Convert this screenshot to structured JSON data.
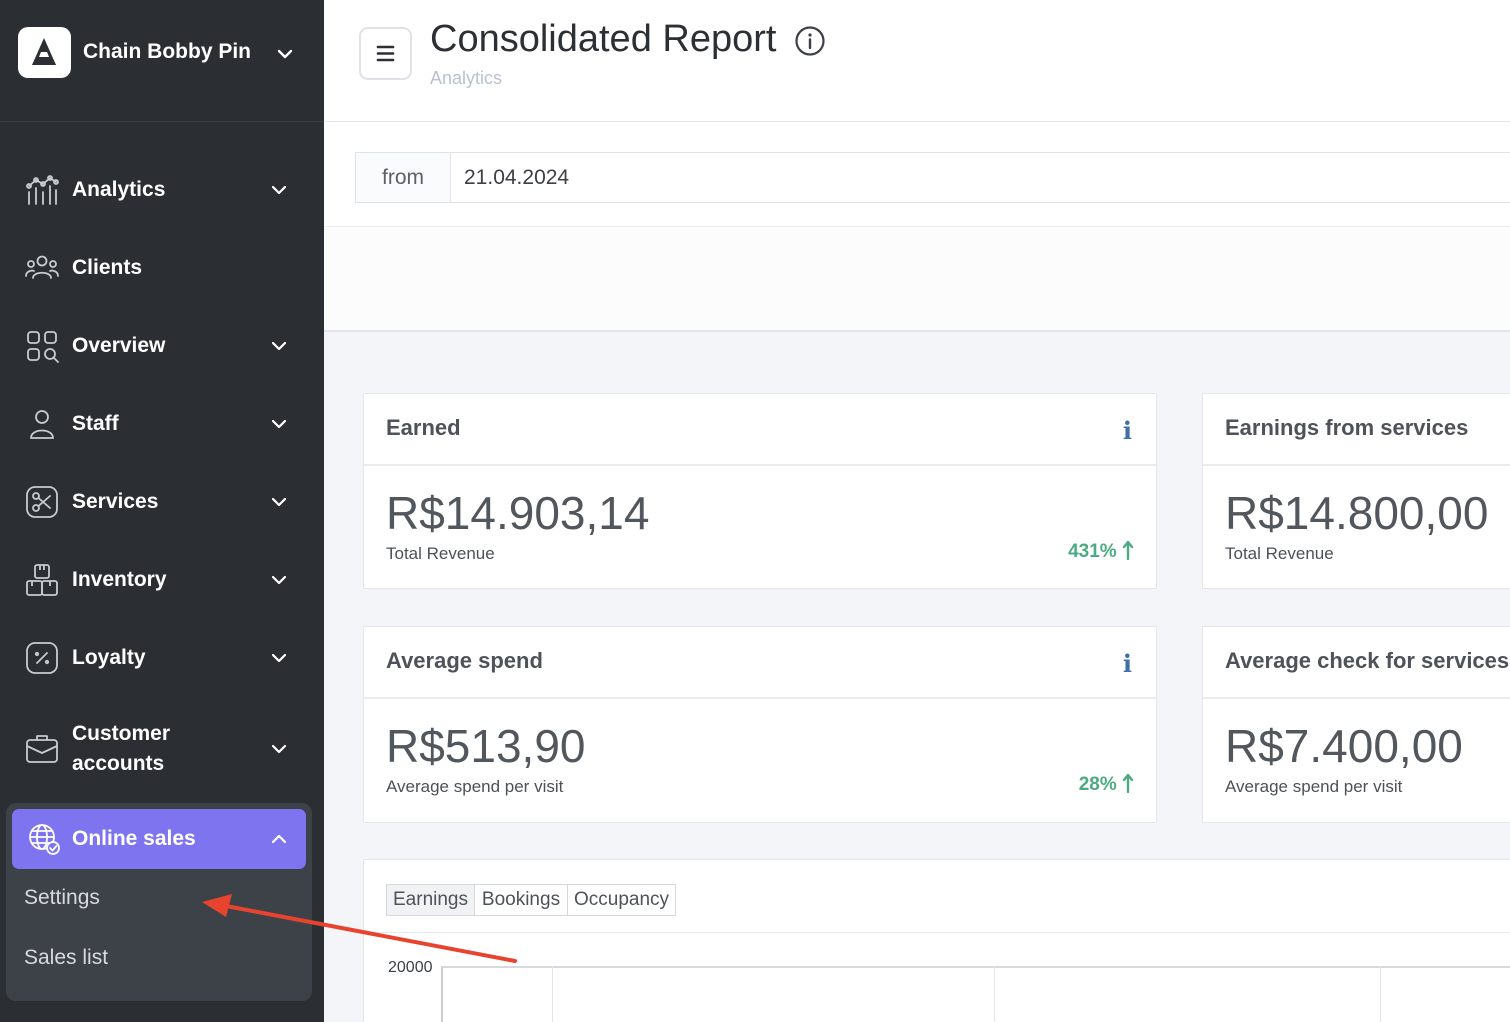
{
  "brand": {
    "name": "Chain Bobby Pin"
  },
  "sidebar": {
    "items": [
      {
        "label": "Analytics",
        "icon": "analytics-icon",
        "expandable": true
      },
      {
        "label": "Clients",
        "icon": "clients-icon",
        "expandable": false
      },
      {
        "label": "Overview",
        "icon": "overview-icon",
        "expandable": true
      },
      {
        "label": "Staff",
        "icon": "staff-icon",
        "expandable": true
      },
      {
        "label": "Services",
        "icon": "services-icon",
        "expandable": true
      },
      {
        "label": "Inventory",
        "icon": "inventory-icon",
        "expandable": true
      },
      {
        "label": "Loyalty",
        "icon": "loyalty-icon",
        "expandable": true
      },
      {
        "label_line1": "Customer",
        "label_line2": "accounts",
        "icon": "customer-accounts-icon",
        "expandable": true
      }
    ],
    "online_sales": {
      "label": "Online sales",
      "icon": "globe-check-icon",
      "expanded": true,
      "subitems": [
        {
          "label": "Settings"
        },
        {
          "label": "Sales list"
        }
      ]
    }
  },
  "header": {
    "title": "Consolidated Report",
    "breadcrumb": "Analytics"
  },
  "filter": {
    "from_label": "from",
    "from_value": "21.04.2024"
  },
  "cards": {
    "earned": {
      "title": "Earned",
      "value": "R$14.903,14",
      "subtitle": "Total Revenue",
      "change": "431%",
      "trend": "up"
    },
    "earnings_services": {
      "title": "Earnings from services",
      "value": "R$14.800,00",
      "subtitle": "Total Revenue"
    },
    "average_spend": {
      "title": "Average spend",
      "value": "R$513,90",
      "subtitle": "Average spend per visit",
      "change": "28%",
      "trend": "up"
    },
    "average_check_services": {
      "title": "Average check for services",
      "value": "R$7.400,00",
      "subtitle": "Average spend per visit"
    }
  },
  "chart": {
    "tabs": [
      "Earnings",
      "Bookings",
      "Occupancy"
    ],
    "active_tab": "Earnings",
    "y_top_tick": "20000"
  },
  "colors": {
    "sidebar_bg": "#2b2f33",
    "accent": "#7f74f0",
    "positive": "#4cab83",
    "info": "#3d6fa8",
    "annotation_arrow": "#e8432e"
  }
}
